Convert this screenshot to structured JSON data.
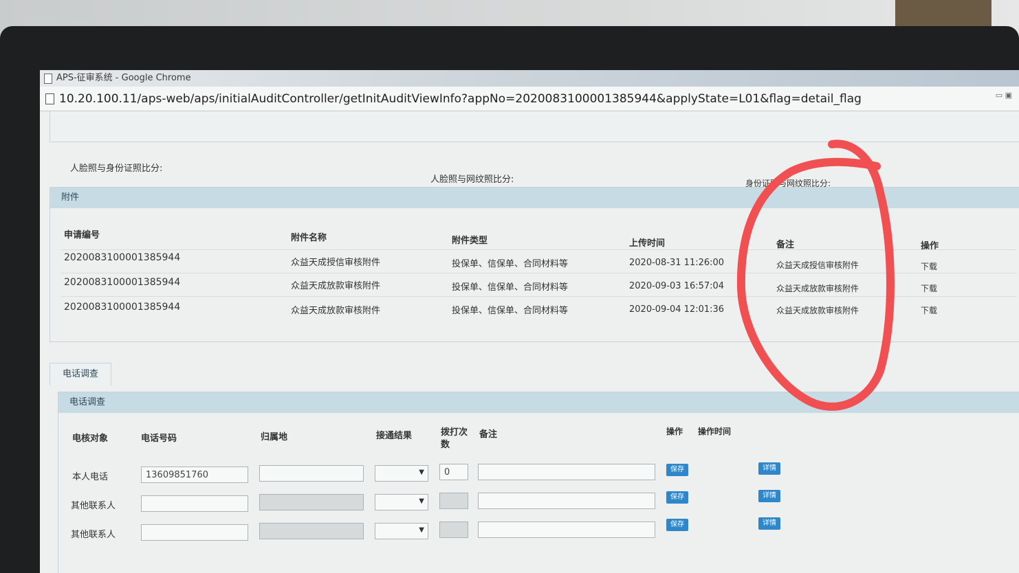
{
  "window": {
    "title": "APS-征审系统 - Google Chrome",
    "url": "10.20.100.11/aps-web/aps/initialAuditController/getInitAuditViewInfo?appNo=2020083100001385944&applyState=L01&flag=detail_flag"
  },
  "compare": {
    "face_id": "人脸照与身份证照比分:",
    "face_net": "人脸照与网纹照比分:",
    "id_net": "身份证照与网纹照比分:"
  },
  "attachments": {
    "panel_title": "附件",
    "headers": {
      "app_no": "申请编号",
      "name": "附件名称",
      "type": "附件类型",
      "time": "上传时间",
      "remark": "备注",
      "action": "操作"
    },
    "rows": [
      {
        "app_no": "2020083100001385944",
        "name": "众益天成授信审核附件",
        "type": "投保单、信保单、合同材料等",
        "time": "2020-08-31 11:26:00",
        "remark": "众益天成授信审核附件",
        "action": "下载"
      },
      {
        "app_no": "2020083100001385944",
        "name": "众益天成放款审核附件",
        "type": "投保单、信保单、合同材料等",
        "time": "2020-09-03 16:57:04",
        "remark": "众益天成放款审核附件",
        "action": "下载"
      },
      {
        "app_no": "2020083100001385944",
        "name": "众益天成放款审核附件",
        "type": "投保单、信保单、合同材料等",
        "time": "2020-09-04 12:01:36",
        "remark": "众益天成放款审核附件",
        "action": "下载"
      }
    ]
  },
  "phone": {
    "tab_label": "电话调查",
    "panel_title": "电话调查",
    "headers": {
      "target": "电核对象",
      "number": "电话号码",
      "location": "归属地",
      "result": "接通结果",
      "count": "拨打次数",
      "remark": "备注",
      "action": "操作",
      "action_time": "操作时间"
    },
    "rows": [
      {
        "target": "本人电话",
        "number": "13609851760",
        "count": "0",
        "save": "保存",
        "detail": "详情"
      },
      {
        "target": "其他联系人",
        "number": "",
        "count": "",
        "save": "保存",
        "detail": "详情"
      },
      {
        "target": "其他联系人",
        "number": "",
        "count": "",
        "save": "保存",
        "detail": "详情"
      }
    ]
  },
  "annotation_color": "#f05052"
}
